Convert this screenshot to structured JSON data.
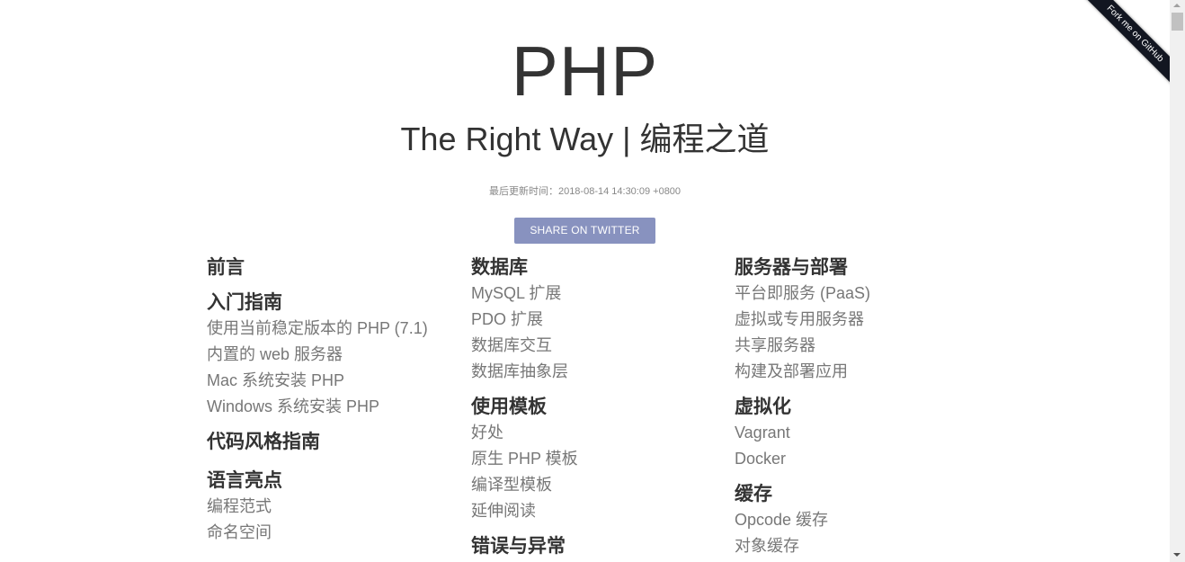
{
  "header": {
    "title": "PHP",
    "subtitle": "The Right Way | 编程之道",
    "updated": "最后更新时间：2018-08-14 14:30:09 +0800",
    "share_label": "SHARE ON TWITTER",
    "ribbon_label": "Fork me on GitHub"
  },
  "colors": {
    "accent": "#8892bf",
    "ribbon": "#121621",
    "heading": "#333333",
    "link": "#777777"
  },
  "toc": {
    "col1": {
      "s0": {
        "title": "前言"
      },
      "s1": {
        "title": "入门指南",
        "items": [
          "使用当前稳定版本的 PHP (7.1)",
          "内置的 web 服务器",
          "Mac 系统安装 PHP",
          "Windows 系统安装 PHP"
        ]
      },
      "s2": {
        "title": "代码风格指南"
      },
      "s3": {
        "title": "语言亮点",
        "items": [
          "编程范式",
          "命名空间"
        ]
      }
    },
    "col2": {
      "s0": {
        "title": "数据库",
        "items": [
          "MySQL 扩展",
          "PDO 扩展",
          "数据库交互",
          "数据库抽象层"
        ]
      },
      "s1": {
        "title": "使用模板",
        "items": [
          "好处",
          "原生 PHP 模板",
          "编译型模板",
          "延伸阅读"
        ]
      },
      "s2": {
        "title": "错误与异常"
      }
    },
    "col3": {
      "s0": {
        "title": "服务器与部署",
        "items": [
          "平台即服务 (PaaS)",
          "虚拟或专用服务器",
          "共享服务器",
          "构建及部署应用"
        ]
      },
      "s1": {
        "title": "虚拟化",
        "items": [
          "Vagrant",
          "Docker"
        ]
      },
      "s2": {
        "title": "缓存",
        "items": [
          "Opcode 缓存",
          "对象缓存"
        ]
      }
    }
  }
}
